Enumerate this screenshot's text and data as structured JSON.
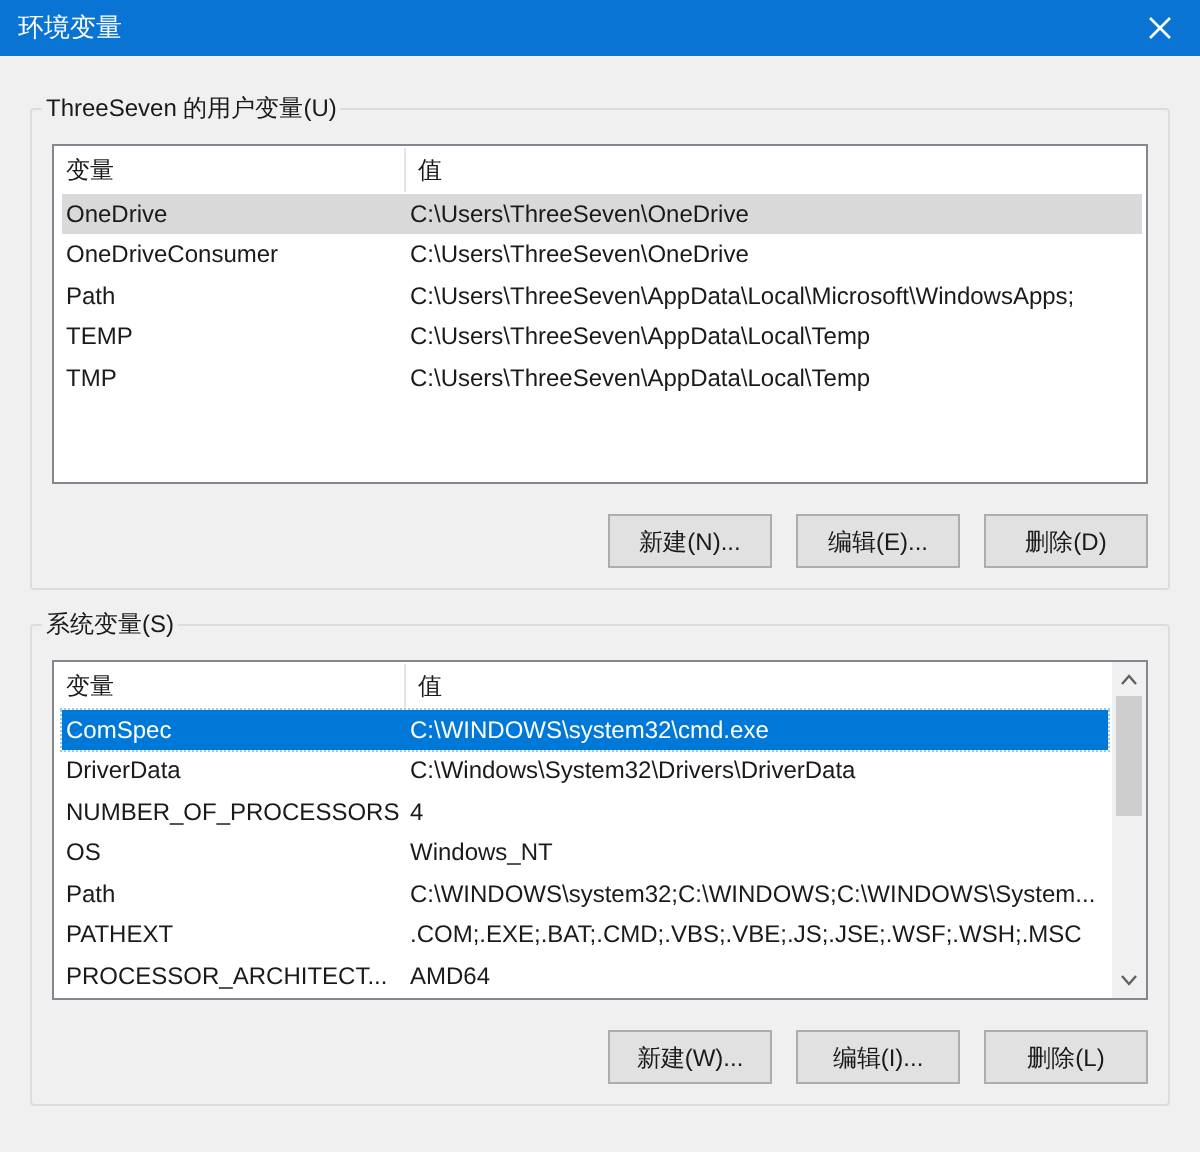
{
  "window": {
    "title": "环境变量"
  },
  "groups": [
    {
      "label": "ThreeSeven 的用户变量(U)",
      "columns": [
        "变量",
        "值"
      ],
      "has_scrollbar": false,
      "focused": false,
      "rows": [
        {
          "name": "OneDrive",
          "value": "C:\\Users\\ThreeSeven\\OneDrive",
          "selected": true
        },
        {
          "name": "OneDriveConsumer",
          "value": "C:\\Users\\ThreeSeven\\OneDrive",
          "selected": false
        },
        {
          "name": "Path",
          "value": "C:\\Users\\ThreeSeven\\AppData\\Local\\Microsoft\\WindowsApps;",
          "selected": false
        },
        {
          "name": "TEMP",
          "value": "C:\\Users\\ThreeSeven\\AppData\\Local\\Temp",
          "selected": false
        },
        {
          "name": "TMP",
          "value": "C:\\Users\\ThreeSeven\\AppData\\Local\\Temp",
          "selected": false
        }
      ],
      "buttons": [
        "新建(N)...",
        "编辑(E)...",
        "删除(D)"
      ]
    },
    {
      "label": "系统变量(S)",
      "columns": [
        "变量",
        "值"
      ],
      "has_scrollbar": true,
      "focused": true,
      "rows": [
        {
          "name": "ComSpec",
          "value": "C:\\WINDOWS\\system32\\cmd.exe",
          "selected": true
        },
        {
          "name": "DriverData",
          "value": "C:\\Windows\\System32\\Drivers\\DriverData",
          "selected": false
        },
        {
          "name": "NUMBER_OF_PROCESSORS",
          "value": "4",
          "selected": false
        },
        {
          "name": "OS",
          "value": "Windows_NT",
          "selected": false
        },
        {
          "name": "Path",
          "value": "C:\\WINDOWS\\system32;C:\\WINDOWS;C:\\WINDOWS\\System...",
          "selected": false
        },
        {
          "name": "PATHEXT",
          "value": ".COM;.EXE;.BAT;.CMD;.VBS;.VBE;.JS;.JSE;.WSF;.WSH;.MSC",
          "selected": false
        },
        {
          "name": "PROCESSOR_ARCHITECT...",
          "value": "AMD64",
          "selected": false
        }
      ],
      "buttons": [
        "新建(W)...",
        "编辑(I)...",
        "删除(L)"
      ]
    }
  ]
}
